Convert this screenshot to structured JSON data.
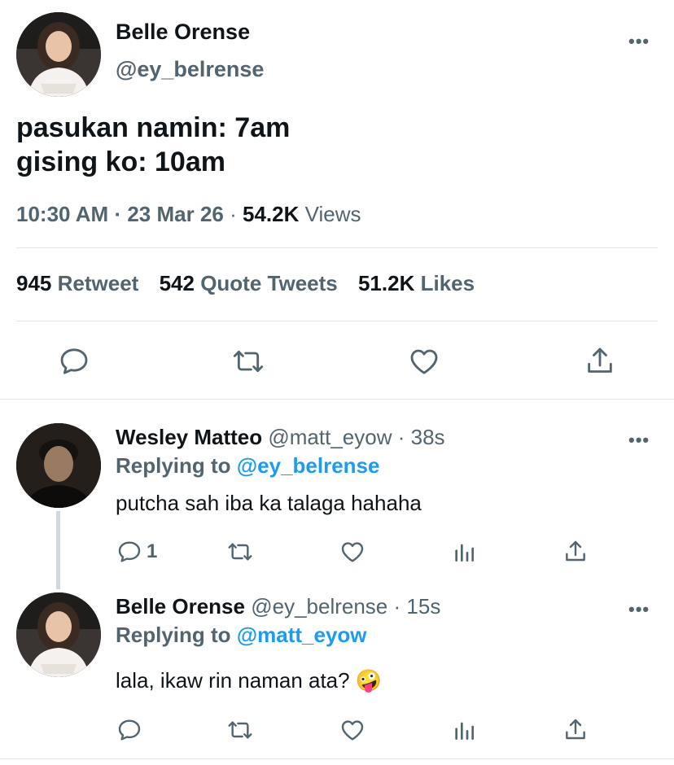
{
  "main_tweet": {
    "author_name": "Belle Orense",
    "author_handle": "@ey_belrense",
    "text_line1": "pasukan namin: 7am",
    "text_line2": "gising ko: 10am",
    "time": "10:30 AM",
    "sep1": "·",
    "date": "23 Mar 26",
    "sep2": "·",
    "views_count": "54.2K",
    "views_label": "Views",
    "retweets_count": "945",
    "retweets_label": "Retweet",
    "quotes_count": "542",
    "quotes_label": "Quote Tweets",
    "likes_count": "51.2K",
    "likes_label": "Likes",
    "more": "•••"
  },
  "reply1": {
    "author_name": "Wesley Matteo",
    "author_handle": "@matt_eyow",
    "sep": "·",
    "age": "38s",
    "replying_prefix": "Replying to",
    "replying_to": "@ey_belrense",
    "text": "putcha sah iba ka talaga hahaha",
    "reply_count": "1",
    "more": "•••"
  },
  "reply2": {
    "author_name": "Belle Orense",
    "author_handle": "@ey_belrense",
    "sep": "·",
    "age": "15s",
    "replying_prefix": "Replying to",
    "replying_to": "@matt_eyow",
    "text": "lala, ikaw rin naman ata?",
    "emoji": "🤪",
    "more": "•••"
  },
  "icons": {
    "reply": "reply-icon",
    "retweet": "retweet-icon",
    "like": "heart-icon",
    "share": "share-icon",
    "analytics": "analytics-icon",
    "more": "more-icon"
  }
}
